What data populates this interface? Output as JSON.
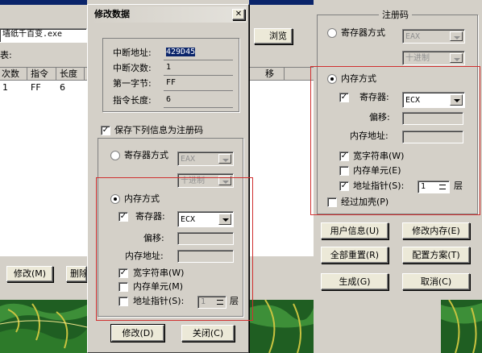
{
  "background_window": {
    "filename": "墙纸千百变.exe",
    "browse_button": "浏览",
    "table_label": "表:",
    "headers": [
      "次数",
      "指令",
      "长度"
    ],
    "row": [
      "1",
      "FF",
      "6"
    ],
    "col_partial": "移",
    "modify_button": "修改(M)",
    "delete_button_partial": "删除"
  },
  "dialog": {
    "title": "修改数据",
    "close_glyph": "✕",
    "fields": [
      {
        "label": "中断地址:",
        "value": "429D45"
      },
      {
        "label": "中断次数:",
        "value": "1"
      },
      {
        "label": "第一字节:",
        "value": "FF"
      },
      {
        "label": "指令长度:",
        "value": "6"
      }
    ],
    "save_checkbox": {
      "label": "保存下列信息为注册码",
      "checked": true
    },
    "register_mode": {
      "label": "寄存器方式",
      "register": "EAX",
      "format": "十进制"
    },
    "memory_mode": {
      "label": "内存方式"
    },
    "register_checkbox": {
      "label": "寄存器:",
      "checked": true
    },
    "register_value": "ECX",
    "offset_label": "偏移:",
    "memory_address_label": "内存地址:",
    "wide_string": {
      "label": "宽字符串(W)",
      "checked": true
    },
    "memory_unit": {
      "label": "内存单元(M)",
      "checked": false
    },
    "address_pointer": {
      "label": "地址指针(S):",
      "checked": false,
      "value": "1",
      "suffix": "层"
    },
    "modify_button": "修改(D)",
    "close_button": "关闭(C)"
  },
  "right_panel": {
    "title": "注册码",
    "register_mode": {
      "label": "寄存器方式",
      "register": "EAX",
      "format": "十进制"
    },
    "memory_mode": {
      "label": "内存方式"
    },
    "register_checkbox": {
      "label": "寄存器:",
      "checked": true
    },
    "register_value": "ECX",
    "offset_label": "偏移:",
    "memory_address_label": "内存地址:",
    "wide_string": {
      "label": "宽字符串(W)",
      "checked": true
    },
    "memory_unit": {
      "label": "内存单元(E)",
      "checked": false
    },
    "address_pointer": {
      "label": "地址指针(S):",
      "checked": true,
      "value": "1",
      "suffix": "层"
    },
    "packed": {
      "label": "经过加壳(P)",
      "checked": false
    },
    "buttons": {
      "user_info": "用户信息(U)",
      "modify_memory": "修改内存(E)",
      "reset_all": "全部重置(R)",
      "config_scheme": "配置方案(T)",
      "generate": "生成(G)",
      "cancel": "取消(C)"
    }
  },
  "colors": {
    "accent": "#d03030",
    "window": "#d4d0c8",
    "selection": "#0a246a",
    "terrain": "#2d7a2a"
  }
}
